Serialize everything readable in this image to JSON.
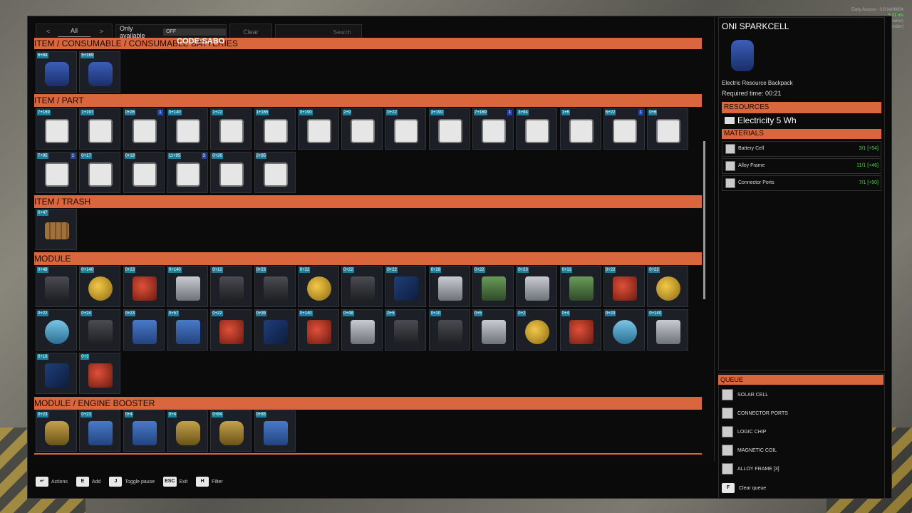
{
  "filter": {
    "category": "All",
    "prev": "<",
    "next": ">"
  },
  "only_available": {
    "label": "Only available",
    "toggle": "OFF"
  },
  "clear_label": "Clear",
  "search_placeholder": "Search",
  "code_label": "CODE:SABO",
  "categories": [
    {
      "title": "ITEM / CONSUMABLE / CONSUMABLE BATTERIES"
    },
    {
      "title": "ITEM / PART"
    },
    {
      "title": "ITEM / TRASH"
    },
    {
      "title": "MODULE"
    },
    {
      "title": "MODULE / ENGINE BOOSTER"
    }
  ],
  "tiles": {
    "batteries": [
      {
        "c": "6+84",
        "i": "blue"
      },
      {
        "c": "5+169",
        "i": "blue"
      }
    ],
    "parts_row1": [
      {
        "c": "7+169",
        "i": "white"
      },
      {
        "c": "1+197",
        "i": "white"
      },
      {
        "c": "0+26",
        "i": "white",
        "b": "1"
      },
      {
        "c": "0+140",
        "i": "white"
      },
      {
        "c": "1+22",
        "i": "white"
      },
      {
        "c": "1+165",
        "i": "white"
      },
      {
        "c": "0+190",
        "i": "white"
      },
      {
        "c": "2+9",
        "i": "white"
      },
      {
        "c": "0+22",
        "i": "white"
      },
      {
        "c": "3+190",
        "i": "white"
      },
      {
        "c": "7+169",
        "i": "white",
        "b": "1"
      },
      {
        "c": "3+84",
        "i": "white"
      },
      {
        "c": "1+6",
        "i": "white"
      },
      {
        "c": "5+22",
        "i": "white",
        "b": "1"
      },
      {
        "c": "0+6",
        "i": "white"
      }
    ],
    "parts_row2": [
      {
        "c": "7+95",
        "i": "white",
        "b": "1"
      },
      {
        "c": "0+17",
        "i": "white"
      },
      {
        "c": "0+19",
        "i": "white"
      },
      {
        "c": "11+95",
        "i": "white",
        "b": "3"
      },
      {
        "c": "0+26",
        "i": "white"
      },
      {
        "c": "2+95",
        "i": "white"
      }
    ],
    "trash": [
      {
        "c": "0+47",
        "i": "wood"
      }
    ],
    "module_row1": [
      {
        "c": "0+48",
        "i": "dark"
      },
      {
        "c": "0+140",
        "i": "yellow"
      },
      {
        "c": "0+23",
        "i": "red"
      },
      {
        "c": "0+140",
        "i": "grey"
      },
      {
        "c": "0+12",
        "i": "dark"
      },
      {
        "c": "0+23",
        "i": "dark"
      },
      {
        "c": "0+22",
        "i": "yellow"
      },
      {
        "c": "0+22",
        "i": "dark"
      },
      {
        "c": "0+22",
        "i": "solar"
      },
      {
        "c": "0+28",
        "i": "grey"
      },
      {
        "c": "0+22",
        "i": "green"
      },
      {
        "c": "0+23",
        "i": "grey"
      },
      {
        "c": "0+11",
        "i": "green"
      },
      {
        "c": "0+22",
        "i": "red"
      },
      {
        "c": "0+22",
        "i": "yellow"
      }
    ],
    "module_row2": [
      {
        "c": "0+22",
        "i": "teal"
      },
      {
        "c": "0+24",
        "i": "dark"
      },
      {
        "c": "0+23",
        "i": "sblue"
      },
      {
        "c": "0+57",
        "i": "sblue"
      },
      {
        "c": "0+22",
        "i": "red"
      },
      {
        "c": "0+39",
        "i": "solar"
      },
      {
        "c": "0+140",
        "i": "red"
      },
      {
        "c": "0+48",
        "i": "grey"
      },
      {
        "c": "0+5",
        "i": "dark"
      },
      {
        "c": "0+10",
        "i": "dark"
      },
      {
        "c": "0+5",
        "i": "grey"
      },
      {
        "c": "0+2",
        "i": "yellow"
      },
      {
        "c": "0+4",
        "i": "red"
      },
      {
        "c": "0+23",
        "i": "teal"
      },
      {
        "c": "0+140",
        "i": "grey"
      }
    ],
    "module_row3": [
      {
        "c": "0+18",
        "i": "solar"
      },
      {
        "c": "0+3",
        "i": "red"
      }
    ],
    "booster": [
      {
        "c": "0+23",
        "i": "gold"
      },
      {
        "c": "0+23",
        "i": "sblue"
      },
      {
        "c": "0+4",
        "i": "sblue"
      },
      {
        "c": "0+4",
        "i": "gold"
      },
      {
        "c": "0+84",
        "i": "gold"
      },
      {
        "c": "0+85",
        "i": "sblue"
      }
    ]
  },
  "hints": [
    {
      "key": "↵",
      "label": "Actions"
    },
    {
      "key": "E",
      "label": "Add"
    },
    {
      "key": "J",
      "label": "Toggle pause"
    },
    {
      "key": "ESC",
      "label": "Exit"
    },
    {
      "key": "H",
      "label": "Filter"
    }
  ],
  "detail": {
    "title": "ONI SPARKCELL",
    "subtitle": "Electric Resource Backpack",
    "required_time": "Required time: 00:21",
    "resources_header": "RESOURCES",
    "electricity": "Electricity  5 Wh",
    "materials_header": "MATERIALS",
    "materials": [
      {
        "name": "Battery Cell",
        "qty": "3/1 [+54]"
      },
      {
        "name": "Alloy Frame",
        "qty": "11/1 [+46]"
      },
      {
        "name": "Connector Ports",
        "qty": "7/1 [+50]"
      }
    ]
  },
  "queue": {
    "header": "QUEUE",
    "items": [
      "SOLAR CELL",
      "CONNECTOR PORTS",
      "LOGIC CHIP",
      "MAGNETIC COIL",
      "ALLOY FRAME   [3]"
    ],
    "clear_key": "F",
    "clear_label": "Clear queue"
  },
  "status": {
    "line1": "Early Access - 0.6.0d06604",
    "line2": "5.21 ms",
    "line3": "25.97 ms (Game)",
    "line4": "8.32 ms (Render)"
  }
}
